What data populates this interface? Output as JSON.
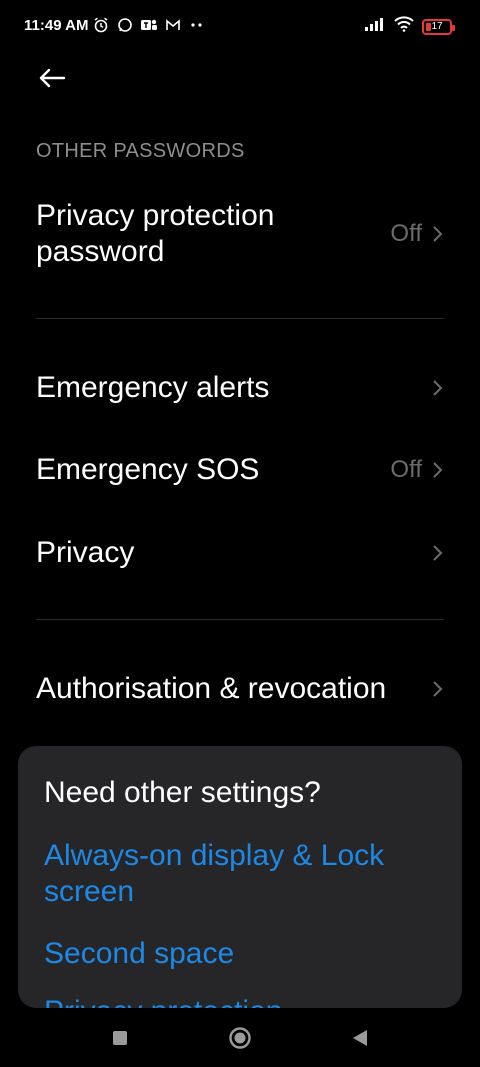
{
  "status_bar": {
    "time": "11:49 AM",
    "left_icons": [
      "alarm-icon",
      "whatsapp-icon",
      "teams-icon",
      "gmail-icon",
      "more-dots-icon"
    ],
    "right_icons": [
      "signal-icon",
      "wifi-icon",
      "battery-icon"
    ],
    "battery_level": "17"
  },
  "header": {
    "back_icon": "arrow-left-icon"
  },
  "section": {
    "other_passwords_label": "OTHER PASSWORDS"
  },
  "rows": {
    "privacy_protection_password": {
      "title": "Privacy protection password",
      "value": "Off"
    },
    "emergency_alerts": {
      "title": "Emergency alerts"
    },
    "emergency_sos": {
      "title": "Emergency SOS",
      "value": "Off"
    },
    "privacy": {
      "title": "Privacy"
    },
    "authorisation_revocation": {
      "title": "Authorisation & revocation"
    }
  },
  "suggestions_card": {
    "title": "Need other settings?",
    "links": [
      "Always-on display & Lock screen",
      "Second space",
      "Privacy protection"
    ]
  },
  "nav_bar": {
    "icons": [
      "recents-square-icon",
      "home-circle-icon",
      "back-triangle-icon"
    ]
  },
  "colors": {
    "background": "#000000",
    "card_background": "#262628",
    "link": "#1e88e5",
    "muted_text": "#8e8e8e",
    "value_text": "#6c6c6c"
  }
}
